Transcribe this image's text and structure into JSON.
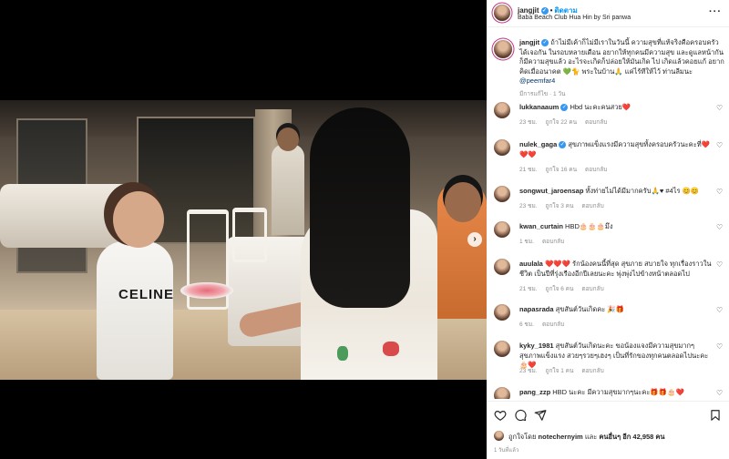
{
  "post": {
    "username": "jangjit",
    "follow_label": "ติดตาม",
    "location": "Baba Beach Club Hua Hin by Sri panwa",
    "image_text": "CELINE"
  },
  "caption": {
    "username": "jangjit",
    "text": "ถ้าไม่มีเค้าก็ไม่มีเราในวันนี้ ความสุขที่แท้จริงคือครอบครัว ได้เจอกัน ในรอบหลายเดือน อยากให้ทุกคนมีความสุข และดูแลหน้ากัน ก็มีความสุขแล้ว อะไรจะเกิดก็ปล่อยให้มันเกิด ไป เกิดแล้วคอยแก้ อยากคิดเมื่ออนาคต 💚🐈 พระในบ้าน🙏 แค่ไร้ทีให้ไว้ ท่านลีมนะ",
    "mention": "@peemfar4",
    "meta_edited": "มีการแก้ไข",
    "meta_time": "1 วัน"
  },
  "comments": [
    {
      "username": "lukkanaaum",
      "verified": true,
      "text": "Hbd นะคะคนสวย❤️",
      "time": "23 ชม.",
      "likes": "ถูกใจ 22 คน",
      "reply": "ตอบกลับ"
    },
    {
      "username": "nulek_gaga",
      "verified": true,
      "text": "สุขภาพแข็งแรงมีความสุขทั้งครอบครัวนะคะที่❤️❤️❤️",
      "time": "21 ชม.",
      "likes": "ถูกใจ 16 คน",
      "reply": "ตอบกลับ"
    },
    {
      "username": "songwut_jaroensap",
      "verified": false,
      "text": "ทั้งท่ายไม่ได้มีมากครับ🙏♥ #4ไร 😊😊",
      "time": "23 ชม.",
      "likes": "ถูกใจ 3 คน",
      "reply": "ตอบกลับ"
    },
    {
      "username": "kwan_curtain",
      "verified": false,
      "text": "HBD🎂🎂🎂มึง",
      "time": "1 ชม.",
      "likes": "",
      "reply": "ตอบกลับ"
    },
    {
      "username": "auulala",
      "verified": false,
      "text": "❤️❤️❤️ รักน้องคนนี้ที่สุด สุขภาย สบายใจ ทุกเรื่องราวในชีวิต เป็นปีที่รุ่งเรืองอีกปีเลยนะคะ พุ่งพุ่งไปข้างหน้าตลอดไป",
      "time": "21 ชม.",
      "likes": "ถูกใจ 6 คน",
      "reply": "ตอบกลับ"
    },
    {
      "username": "napasrada",
      "verified": false,
      "text": "สุขสันต์วันเกิดคะ 🎉🎁",
      "time": "6 ชม.",
      "likes": "",
      "reply": "ตอบกลับ"
    },
    {
      "username": "kyky_1981",
      "verified": false,
      "text": "สุขสันต์วันเกิดนะคะ ขอน้องแจงมีความสุขมากๆสุขภาพแข็งแรง สวยๆรวยๆเฮงๆ เป็นที่รักของทุกคนตลอดไปนะคะ🎂❤️",
      "time": "23 ชม.",
      "likes": "ถูกใจ 1 คน",
      "reply": "ตอบกลับ"
    },
    {
      "username": "pang_zzp",
      "verified": false,
      "text": "HBD นะคะ มีความสุขมากๆนะคะ🎁🎁🎂❤️",
      "time": "",
      "likes": "",
      "reply": ""
    }
  ],
  "likes": {
    "text_prefix": "ถูกใจโดย",
    "user": "notechernyim",
    "text_mid": "และ",
    "others": "คนอื่นๆ อีก 42,958 คน"
  },
  "date": "1 วันที่แล้ว"
}
